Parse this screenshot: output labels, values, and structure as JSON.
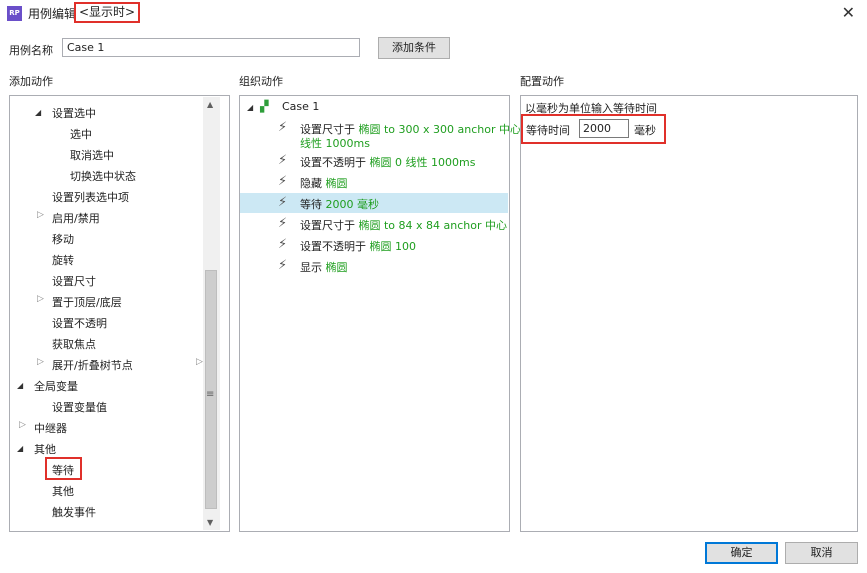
{
  "window": {
    "app_icon": "RP",
    "title": "用例编辑",
    "title_suffix": "<显示时>",
    "close_label": "✕"
  },
  "case_name": {
    "label": "用例名称",
    "value": "Case 1",
    "add_condition_label": "添加条件"
  },
  "sections": {
    "add_action": "添加动作",
    "organize_action": "组织动作",
    "config_action": "配置动作"
  },
  "add_tree": [
    {
      "label": "设置选中"
    },
    {
      "label": "选中"
    },
    {
      "label": "取消选中"
    },
    {
      "label": "切换选中状态"
    },
    {
      "label": "设置列表选中项"
    },
    {
      "label": "启用/禁用"
    },
    {
      "label": "移动"
    },
    {
      "label": "旋转"
    },
    {
      "label": "设置尺寸"
    },
    {
      "label": "置于顶层/底层"
    },
    {
      "label": "设置不透明"
    },
    {
      "label": "获取焦点"
    },
    {
      "label": "展开/折叠树节点"
    },
    {
      "label": "全局变量"
    },
    {
      "label": "设置变量值"
    },
    {
      "label": "中继器"
    },
    {
      "label": "其他"
    },
    {
      "label": "等待"
    },
    {
      "label": "其他"
    },
    {
      "label": "触发事件"
    }
  ],
  "organize": {
    "case_label": "Case 1",
    "actions": [
      {
        "prefix": "设置尺寸于",
        "detail": "椭圆 to 300 x 300 anchor 中心",
        "detail2": "线性 1000ms"
      },
      {
        "prefix": "设置不透明于",
        "detail": "椭圆 0 线性 1000ms",
        "detail2": ""
      },
      {
        "prefix": "隐藏",
        "detail": "椭圆",
        "detail2": ""
      },
      {
        "prefix": "等待",
        "detail": "2000 毫秒",
        "detail2": ""
      },
      {
        "prefix": "设置尺寸于",
        "detail": "椭圆 to 84 x 84 anchor 中心",
        "detail2": ""
      },
      {
        "prefix": "设置不透明于",
        "detail": "椭圆 100",
        "detail2": ""
      },
      {
        "prefix": "显示",
        "detail": "椭圆",
        "detail2": ""
      }
    ]
  },
  "config": {
    "instruction": "以毫秒为单位输入等待时间",
    "wait_label": "等待时间",
    "wait_value": "2000",
    "unit": "毫秒"
  },
  "footer": {
    "ok_label": "确定",
    "cancel_label": "取消"
  },
  "colors": {
    "highlight_red": "#e0302a",
    "selected_row": "#cce8f4",
    "green_text": "#1f9e1f"
  }
}
